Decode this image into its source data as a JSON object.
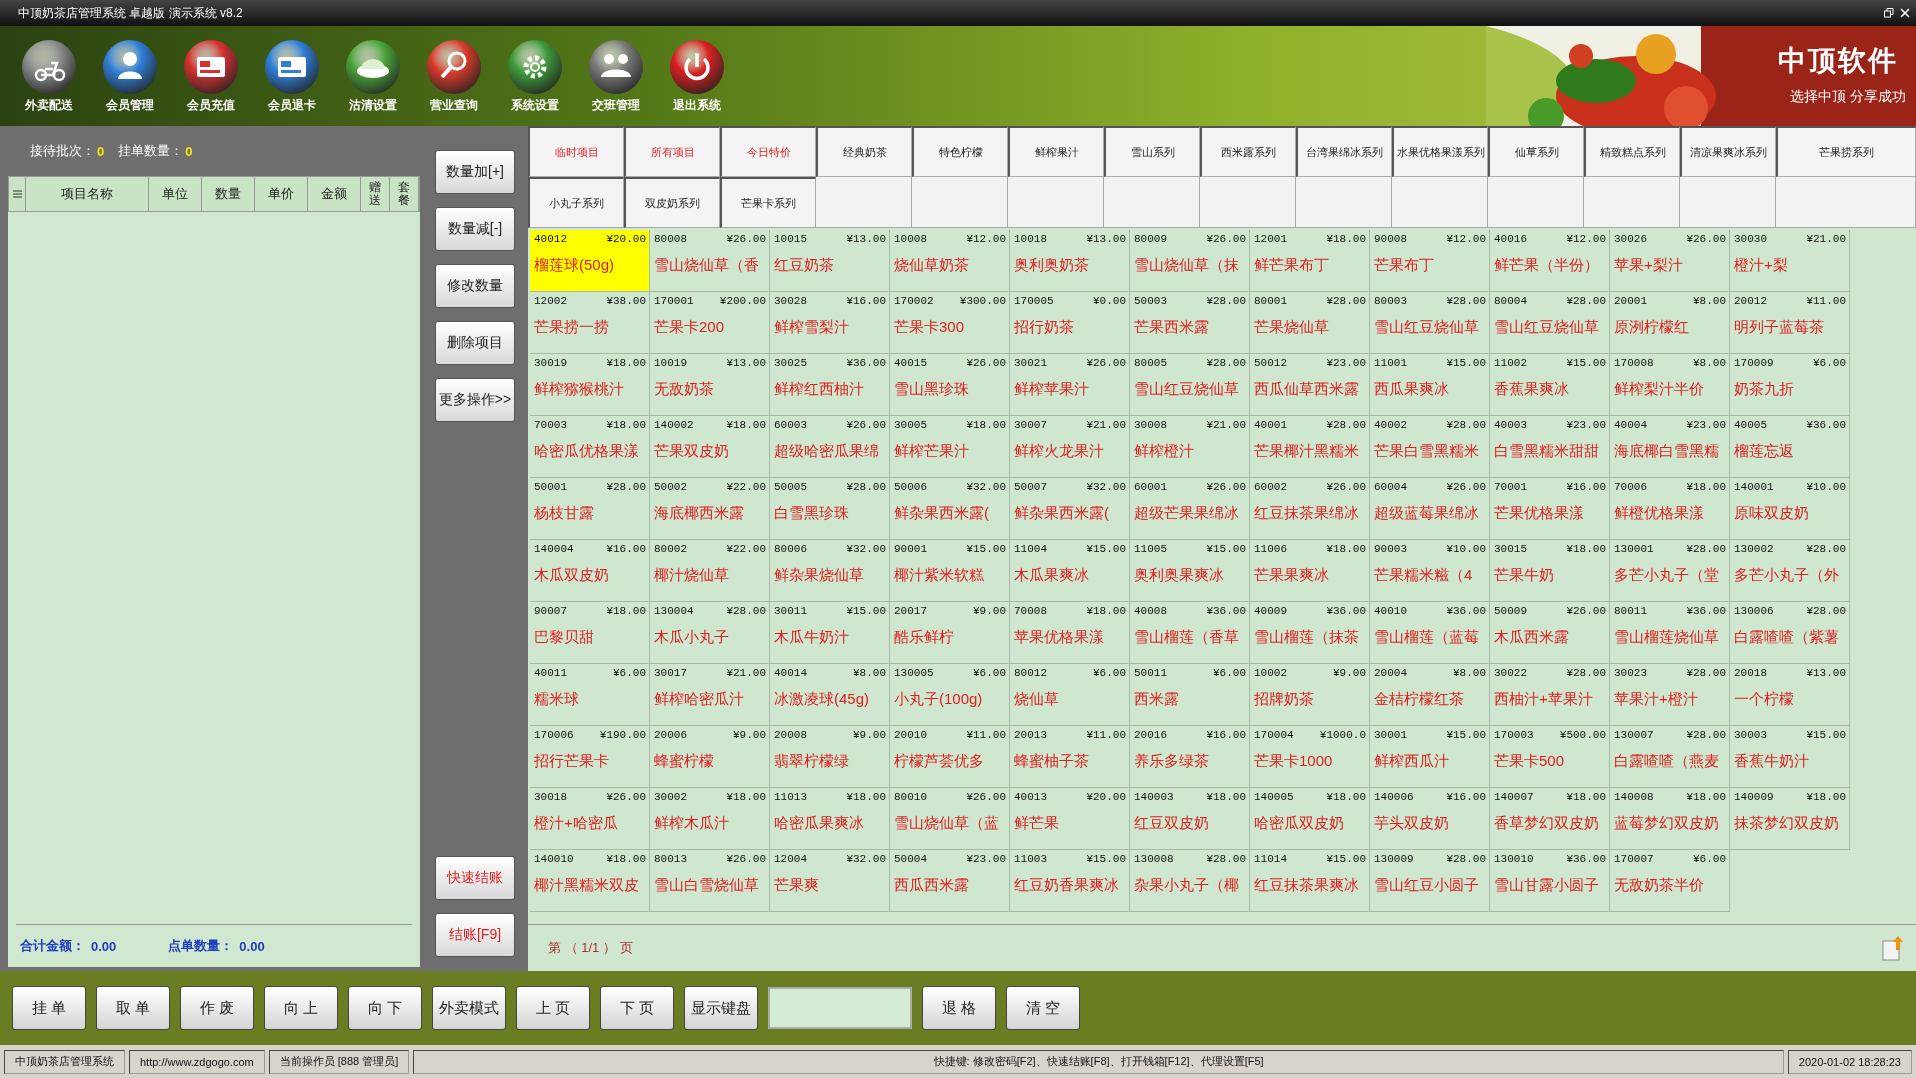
{
  "window": {
    "title": "中顶奶茶店管理系统 卓越版 演示系统 v8.2"
  },
  "toolbar": [
    {
      "label": "外卖配送"
    },
    {
      "label": "会员管理"
    },
    {
      "label": "会员充值"
    },
    {
      "label": "会员退卡"
    },
    {
      "label": "沽清设置"
    },
    {
      "label": "营业查询"
    },
    {
      "label": "系统设置"
    },
    {
      "label": "交班管理"
    },
    {
      "label": "退出系统"
    }
  ],
  "banner": {
    "title": "中顶软件",
    "slogan": "选择中顶 分享成功"
  },
  "order_panel": {
    "batches_label": "接待批次：",
    "batches": "0",
    "pending_label": "挂单数量：",
    "pending": "0",
    "columns": [
      {
        "label": "项目名称",
        "kind": "wide"
      },
      {
        "label": "单位",
        "kind": "normal"
      },
      {
        "label": "数量",
        "kind": "normal"
      },
      {
        "label": "单价",
        "kind": "normal"
      },
      {
        "label": "金额",
        "kind": "normal"
      },
      {
        "label": "赠送",
        "kind": "narrow"
      },
      {
        "label": "套餐",
        "kind": "narrow"
      }
    ],
    "total_label": "合计金额：",
    "total": "0.00",
    "count_label": "点单数量：",
    "count": "0.00"
  },
  "side_buttons": [
    {
      "label": "数量加[+]",
      "kind": "normal"
    },
    {
      "label": "数量减[-]",
      "kind": "normal"
    },
    {
      "label": "修改数量",
      "kind": "normal"
    },
    {
      "label": "删除项目",
      "kind": "normal"
    },
    {
      "label": "更多操作>>",
      "kind": "normal"
    },
    {
      "label": "快速结账",
      "kind": "checkout"
    },
    {
      "label": "结账[F9]",
      "kind": "checkout"
    }
  ],
  "category_tabs": [
    {
      "label": "临时项目",
      "kind": "special"
    },
    {
      "label": "所有项目",
      "kind": "special"
    },
    {
      "label": "今日特价",
      "kind": "special"
    },
    {
      "label": "经典奶茶",
      "kind": "normal"
    },
    {
      "label": "特色柠檬",
      "kind": "normal"
    },
    {
      "label": "鲜榨果汁",
      "kind": "normal"
    },
    {
      "label": "雪山系列",
      "kind": "normal"
    },
    {
      "label": "西米露系列",
      "kind": "normal"
    },
    {
      "label": "台湾果绵冰系列",
      "kind": "normal"
    },
    {
      "label": "水果优格果漾系列",
      "kind": "normal"
    },
    {
      "label": "仙草系列",
      "kind": "normal"
    },
    {
      "label": "精致糕点系列",
      "kind": "normal"
    },
    {
      "label": "清凉果爽冰系列",
      "kind": "normal"
    },
    {
      "label": "芒果捞系列",
      "kind": "normal"
    },
    {
      "label": "小丸子系列",
      "kind": "normal"
    },
    {
      "label": "双皮奶系列",
      "kind": "normal"
    },
    {
      "label": "芒果卡系列",
      "kind": "normal"
    }
  ],
  "products": [
    {
      "code": "40012",
      "price": "¥20.00",
      "name": "榴莲球(50g)",
      "selected": true
    },
    {
      "code": "80008",
      "price": "¥26.00",
      "name": "雪山烧仙草（香",
      "selected": false
    },
    {
      "code": "10015",
      "price": "¥13.00",
      "name": "红豆奶茶",
      "selected": false
    },
    {
      "code": "10008",
      "price": "¥12.00",
      "name": "烧仙草奶茶",
      "selected": false
    },
    {
      "code": "10018",
      "price": "¥13.00",
      "name": "奥利奥奶茶",
      "selected": false
    },
    {
      "code": "80009",
      "price": "¥26.00",
      "name": "雪山烧仙草（抹",
      "selected": false
    },
    {
      "code": "12001",
      "price": "¥18.00",
      "name": "鲜芒果布丁",
      "selected": false
    },
    {
      "code": "90008",
      "price": "¥12.00",
      "name": "芒果布丁",
      "selected": false
    },
    {
      "code": "40016",
      "price": "¥12.00",
      "name": "鲜芒果（半份）",
      "selected": false
    },
    {
      "code": "30026",
      "price": "¥26.00",
      "name": "苹果+梨汁",
      "selected": false
    },
    {
      "code": "30030",
      "price": "¥21.00",
      "name": "橙汁+梨",
      "selected": false
    },
    {
      "code": "12002",
      "price": "¥38.00",
      "name": "芒果捞一捞",
      "selected": false
    },
    {
      "code": "170001",
      "price": "¥200.00",
      "name": "芒果卡200",
      "selected": false
    },
    {
      "code": "30028",
      "price": "¥16.00",
      "name": "鲜榨雪梨汁",
      "selected": false
    },
    {
      "code": "170002",
      "price": "¥300.00",
      "name": "芒果卡300",
      "selected": false
    },
    {
      "code": "170005",
      "price": "¥0.00",
      "name": "招行奶茶",
      "selected": false
    },
    {
      "code": "50003",
      "price": "¥28.00",
      "name": "芒果西米露",
      "selected": false
    },
    {
      "code": "80001",
      "price": "¥28.00",
      "name": "芒果烧仙草",
      "selected": false
    },
    {
      "code": "80003",
      "price": "¥28.00",
      "name": "雪山红豆烧仙草",
      "selected": false
    },
    {
      "code": "80004",
      "price": "¥28.00",
      "name": "雪山红豆烧仙草",
      "selected": false
    },
    {
      "code": "20001",
      "price": "¥8.00",
      "name": "原洌柠檬红",
      "selected": false
    },
    {
      "code": "20012",
      "price": "¥11.00",
      "name": "明列子蓝莓茶",
      "selected": false
    },
    {
      "code": "30019",
      "price": "¥18.00",
      "name": "鲜榨猕猴桃汁",
      "selected": false
    },
    {
      "code": "10019",
      "price": "¥13.00",
      "name": "无敌奶茶",
      "selected": false
    },
    {
      "code": "30025",
      "price": "¥36.00",
      "name": "鲜榨红西柚汁",
      "selected": false
    },
    {
      "code": "40015",
      "price": "¥26.00",
      "name": "雪山黑珍珠",
      "selected": false
    },
    {
      "code": "30021",
      "price": "¥26.00",
      "name": "鲜榨苹果汁",
      "selected": false
    },
    {
      "code": "80005",
      "price": "¥28.00",
      "name": "雪山红豆烧仙草",
      "selected": false
    },
    {
      "code": "50012",
      "price": "¥23.00",
      "name": "西瓜仙草西米露",
      "selected": false
    },
    {
      "code": "11001",
      "price": "¥15.00",
      "name": "西瓜果爽冰",
      "selected": false
    },
    {
      "code": "11002",
      "price": "¥15.00",
      "name": "香蕉果爽冰",
      "selected": false
    },
    {
      "code": "170008",
      "price": "¥8.00",
      "name": "鲜榨梨汁半价",
      "selected": false
    },
    {
      "code": "170009",
      "price": "¥6.00",
      "name": "奶茶九折",
      "selected": false
    },
    {
      "code": "70003",
      "price": "¥18.00",
      "name": "哈密瓜优格果漾",
      "selected": false
    },
    {
      "code": "140002",
      "price": "¥18.00",
      "name": "芒果双皮奶",
      "selected": false
    },
    {
      "code": "60003",
      "price": "¥26.00",
      "name": "超级哈密瓜果绵",
      "selected": false
    },
    {
      "code": "30005",
      "price": "¥18.00",
      "name": "鲜榨芒果汁",
      "selected": false
    },
    {
      "code": "30007",
      "price": "¥21.00",
      "name": "鲜榨火龙果汁",
      "selected": false
    },
    {
      "code": "30008",
      "price": "¥21.00",
      "name": "鲜榨橙汁",
      "selected": false
    },
    {
      "code": "40001",
      "price": "¥28.00",
      "name": "芒果椰汁黑糯米",
      "selected": false
    },
    {
      "code": "40002",
      "price": "¥28.00",
      "name": "芒果白雪黑糯米",
      "selected": false
    },
    {
      "code": "40003",
      "price": "¥23.00",
      "name": "白雪黑糯米甜甜",
      "selected": false
    },
    {
      "code": "40004",
      "price": "¥23.00",
      "name": "海底椰白雪黑糯",
      "selected": false
    },
    {
      "code": "40005",
      "price": "¥36.00",
      "name": "榴莲忘返",
      "selected": false
    },
    {
      "code": "50001",
      "price": "¥28.00",
      "name": "杨枝甘露",
      "selected": false
    },
    {
      "code": "50002",
      "price": "¥22.00",
      "name": "海底椰西米露",
      "selected": false
    },
    {
      "code": "50005",
      "price": "¥28.00",
      "name": "白雪黑珍珠",
      "selected": false
    },
    {
      "code": "50006",
      "price": "¥32.00",
      "name": "鲜杂果西米露(",
      "selected": false
    },
    {
      "code": "50007",
      "price": "¥32.00",
      "name": "鲜杂果西米露(",
      "selected": false
    },
    {
      "code": "60001",
      "price": "¥26.00",
      "name": "超级芒果果绵冰",
      "selected": false
    },
    {
      "code": "60002",
      "price": "¥26.00",
      "name": "红豆抹茶果绵冰",
      "selected": false
    },
    {
      "code": "60004",
      "price": "¥26.00",
      "name": "超级蓝莓果绵冰",
      "selected": false
    },
    {
      "code": "70001",
      "price": "¥16.00",
      "name": "芒果优格果漾",
      "selected": false
    },
    {
      "code": "70006",
      "price": "¥18.00",
      "name": "鲜橙优格果漾",
      "selected": false
    },
    {
      "code": "140001",
      "price": "¥10.00",
      "name": "原味双皮奶",
      "selected": false
    },
    {
      "code": "140004",
      "price": "¥16.00",
      "name": "木瓜双皮奶",
      "selected": false
    },
    {
      "code": "80002",
      "price": "¥22.00",
      "name": "椰汁烧仙草",
      "selected": false
    },
    {
      "code": "80006",
      "price": "¥32.00",
      "name": "鲜杂果烧仙草",
      "selected": false
    },
    {
      "code": "90001",
      "price": "¥15.00",
      "name": "椰汁紫米软糕",
      "selected": false
    },
    {
      "code": "11004",
      "price": "¥15.00",
      "name": "木瓜果爽冰",
      "selected": false
    },
    {
      "code": "11005",
      "price": "¥15.00",
      "name": "奥利奥果爽冰",
      "selected": false
    },
    {
      "code": "11006",
      "price": "¥18.00",
      "name": "芒果果爽冰",
      "selected": false
    },
    {
      "code": "90003",
      "price": "¥10.00",
      "name": "芒果糯米糍（4",
      "selected": false
    },
    {
      "code": "30015",
      "price": "¥18.00",
      "name": "芒果牛奶",
      "selected": false
    },
    {
      "code": "130001",
      "price": "¥28.00",
      "name": "多芒小丸子（堂",
      "selected": false
    },
    {
      "code": "130002",
      "price": "¥28.00",
      "name": "多芒小丸子（外",
      "selected": false
    },
    {
      "code": "90007",
      "price": "¥18.00",
      "name": "巴黎贝甜",
      "selected": false
    },
    {
      "code": "130004",
      "price": "¥28.00",
      "name": "木瓜小丸子",
      "selected": false
    },
    {
      "code": "30011",
      "price": "¥15.00",
      "name": "木瓜牛奶汁",
      "selected": false
    },
    {
      "code": "20017",
      "price": "¥9.00",
      "name": "酷乐鲜柠",
      "selected": false
    },
    {
      "code": "70008",
      "price": "¥18.00",
      "name": "苹果优格果漾",
      "selected": false
    },
    {
      "code": "40008",
      "price": "¥36.00",
      "name": "雪山榴莲（香草",
      "selected": false
    },
    {
      "code": "40009",
      "price": "¥36.00",
      "name": "雪山榴莲（抹茶",
      "selected": false
    },
    {
      "code": "40010",
      "price": "¥36.00",
      "name": "雪山榴莲（蓝莓",
      "selected": false
    },
    {
      "code": "50009",
      "price": "¥26.00",
      "name": "木瓜西米露",
      "selected": false
    },
    {
      "code": "80011",
      "price": "¥36.00",
      "name": "雪山榴莲烧仙草",
      "selected": false
    },
    {
      "code": "130006",
      "price": "¥28.00",
      "name": "白露喳喳（紫薯",
      "selected": false
    },
    {
      "code": "40011",
      "price": "¥6.00",
      "name": "糯米球",
      "selected": false
    },
    {
      "code": "30017",
      "price": "¥21.00",
      "name": "鲜榨哈密瓜汁",
      "selected": false
    },
    {
      "code": "40014",
      "price": "¥8.00",
      "name": "冰激凌球(45g)",
      "selected": false
    },
    {
      "code": "130005",
      "price": "¥6.00",
      "name": "小丸子(100g)",
      "selected": false
    },
    {
      "code": "80012",
      "price": "¥6.00",
      "name": "烧仙草",
      "selected": false
    },
    {
      "code": "50011",
      "price": "¥6.00",
      "name": "西米露",
      "selected": false
    },
    {
      "code": "10002",
      "price": "¥9.00",
      "name": "招牌奶茶",
      "selected": false
    },
    {
      "code": "20004",
      "price": "¥8.00",
      "name": "金桔柠檬红茶",
      "selected": false
    },
    {
      "code": "30022",
      "price": "¥28.00",
      "name": "西柚汁+苹果汁",
      "selected": false
    },
    {
      "code": "30023",
      "price": "¥28.00",
      "name": "苹果汁+橙汁",
      "selected": false
    },
    {
      "code": "20018",
      "price": "¥13.00",
      "name": "一个柠檬",
      "selected": false
    },
    {
      "code": "170006",
      "price": "¥190.00",
      "name": "招行芒果卡",
      "selected": false
    },
    {
      "code": "20006",
      "price": "¥9.00",
      "name": "蜂蜜柠檬",
      "selected": false
    },
    {
      "code": "20008",
      "price": "¥9.00",
      "name": "翡翠柠檬绿",
      "selected": false
    },
    {
      "code": "20010",
      "price": "¥11.00",
      "name": "柠檬芦荟优多",
      "selected": false
    },
    {
      "code": "20013",
      "price": "¥11.00",
      "name": "蜂蜜柚子茶",
      "selected": false
    },
    {
      "code": "20016",
      "price": "¥16.00",
      "name": "养乐多绿茶",
      "selected": false
    },
    {
      "code": "170004",
      "price": "¥1000.0",
      "name": "芒果卡1000",
      "selected": false
    },
    {
      "code": "30001",
      "price": "¥15.00",
      "name": "鲜榨西瓜汁",
      "selected": false
    },
    {
      "code": "170003",
      "price": "¥500.00",
      "name": "芒果卡500",
      "selected": false
    },
    {
      "code": "130007",
      "price": "¥28.00",
      "name": "白露喳喳（燕麦",
      "selected": false
    },
    {
      "code": "30003",
      "price": "¥15.00",
      "name": "香蕉牛奶汁",
      "selected": false
    },
    {
      "code": "30018",
      "price": "¥26.00",
      "name": "橙汁+哈密瓜",
      "selected": false
    },
    {
      "code": "30002",
      "price": "¥18.00",
      "name": "鲜榨木瓜汁",
      "selected": false
    },
    {
      "code": "11013",
      "price": "¥18.00",
      "name": "哈密瓜果爽冰",
      "selected": false
    },
    {
      "code": "80010",
      "price": "¥26.00",
      "name": "雪山烧仙草（蓝",
      "selected": false
    },
    {
      "code": "40013",
      "price": "¥20.00",
      "name": "鲜芒果",
      "selected": false
    },
    {
      "code": "140003",
      "price": "¥18.00",
      "name": "红豆双皮奶",
      "selected": false
    },
    {
      "code": "140005",
      "price": "¥18.00",
      "name": "哈密瓜双皮奶",
      "selected": false
    },
    {
      "code": "140006",
      "price": "¥16.00",
      "name": "芋头双皮奶",
      "selected": false
    },
    {
      "code": "140007",
      "price": "¥18.00",
      "name": "香草梦幻双皮奶",
      "selected": false
    },
    {
      "code": "140008",
      "price": "¥18.00",
      "name": "蓝莓梦幻双皮奶",
      "selected": false
    },
    {
      "code": "140009",
      "price": "¥18.00",
      "name": "抹茶梦幻双皮奶",
      "selected": false
    },
    {
      "code": "140010",
      "price": "¥18.00",
      "name": "椰汁黑糯米双皮",
      "selected": false
    },
    {
      "code": "80013",
      "price": "¥26.00",
      "name": "雪山白雪烧仙草",
      "selected": false
    },
    {
      "code": "12004",
      "price": "¥32.00",
      "name": "芒果爽",
      "selected": false
    },
    {
      "code": "50004",
      "price": "¥23.00",
      "name": "西瓜西米露",
      "selected": false
    },
    {
      "code": "11003",
      "price": "¥15.00",
      "name": "红豆奶香果爽冰",
      "selected": false
    },
    {
      "code": "130008",
      "price": "¥28.00",
      "name": "杂果小丸子（椰",
      "selected": false
    },
    {
      "code": "11014",
      "price": "¥15.00",
      "name": "红豆抹茶果爽冰",
      "selected": false
    },
    {
      "code": "130009",
      "price": "¥28.00",
      "name": "雪山红豆小圆子",
      "selected": false
    },
    {
      "code": "130010",
      "price": "¥36.00",
      "name": "雪山甘露小圆子",
      "selected": false
    },
    {
      "code": "170007",
      "price": "¥6.00",
      "name": "无敌奶茶半价",
      "selected": false
    }
  ],
  "pager": {
    "label": "第 （ 1/1 ） 页"
  },
  "bottom_bar": {
    "left": [
      "挂 单",
      "取 单",
      "作 废",
      "向 上",
      "向 下",
      "外卖模式",
      "上 页",
      "下 页",
      "显示键盘"
    ],
    "right": [
      "退 格",
      "清 空"
    ]
  },
  "status_bar": [
    "中顶奶茶店管理系统",
    "http://www.zdgogo.com",
    "当前操作员 [888 管理员]",
    "快捷键:  修改密码[F2]、快速结账[F8]、打开钱箱[F12]、代理设置[F5]",
    "2020-01-02 18:28:23"
  ]
}
